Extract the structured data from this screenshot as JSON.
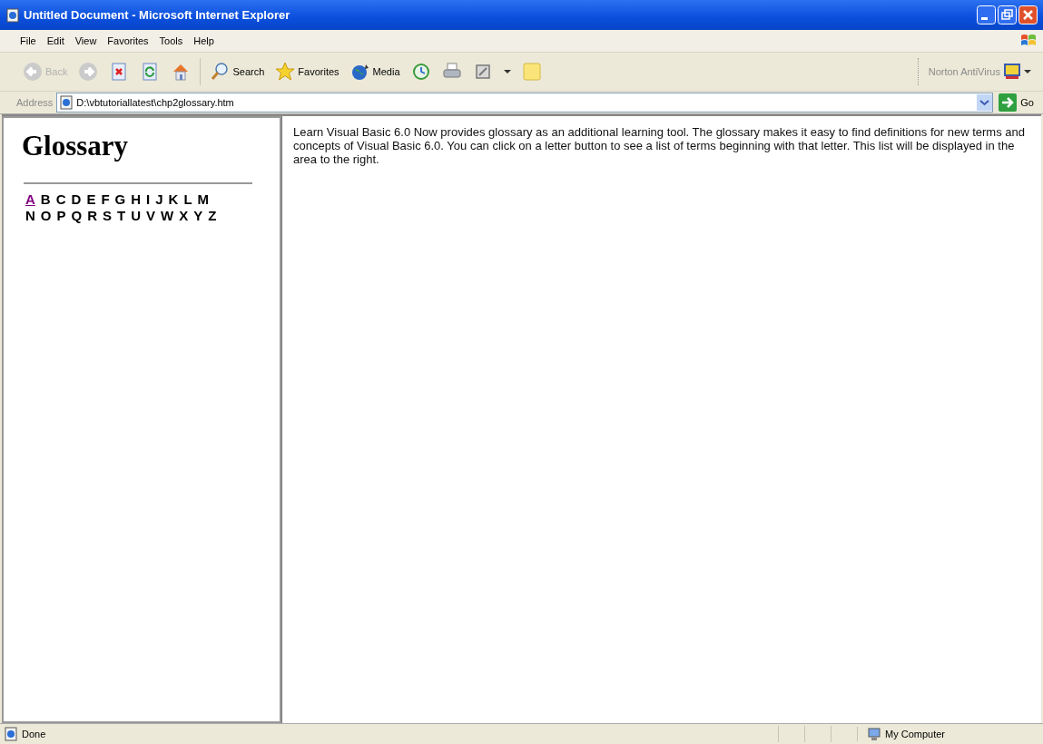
{
  "window": {
    "title": "Untitled Document - Microsoft Internet Explorer"
  },
  "menu": [
    "File",
    "Edit",
    "View",
    "Favorites",
    "Tools",
    "Help"
  ],
  "toolbar": [
    {
      "kind": "back",
      "label": "Back",
      "disabled": true
    },
    {
      "kind": "forward",
      "disabled": true
    },
    {
      "kind": "stop"
    },
    {
      "kind": "refresh"
    },
    {
      "kind": "home"
    },
    {
      "kind": "sep"
    },
    {
      "kind": "search",
      "label": "Search"
    },
    {
      "kind": "favorites",
      "label": "Favorites"
    },
    {
      "kind": "media",
      "label": "Media"
    },
    {
      "kind": "history"
    },
    {
      "kind": "print"
    },
    {
      "kind": "edit"
    },
    {
      "kind": "dropdown"
    },
    {
      "kind": "note"
    }
  ],
  "norton": {
    "label": "Norton AntiVirus"
  },
  "address": {
    "label": "Address",
    "value": "D:\\vbtutoriallatest\\chp2glossary.htm",
    "go": "Go"
  },
  "left_frame": {
    "heading": "Glossary",
    "letter_rows": [
      [
        {
          "letter": "A",
          "visited": true
        },
        {
          "letter": "B",
          "visited": false
        },
        {
          "letter": "C",
          "visited": false
        },
        {
          "letter": "D",
          "visited": false
        },
        {
          "letter": "E",
          "visited": false
        },
        {
          "letter": "F",
          "visited": false
        },
        {
          "letter": "G",
          "visited": false
        },
        {
          "letter": "H",
          "visited": false
        },
        {
          "letter": "I",
          "visited": false
        },
        {
          "letter": "J",
          "visited": false
        },
        {
          "letter": "K",
          "visited": false
        },
        {
          "letter": "L",
          "visited": false
        },
        {
          "letter": "M",
          "visited": false
        }
      ],
      [
        {
          "letter": "N",
          "visited": false
        },
        {
          "letter": "O",
          "visited": false
        },
        {
          "letter": "P",
          "visited": false
        },
        {
          "letter": "Q",
          "visited": false
        },
        {
          "letter": "R",
          "visited": false
        },
        {
          "letter": "S",
          "visited": false
        },
        {
          "letter": "T",
          "visited": false
        },
        {
          "letter": "U",
          "visited": false
        },
        {
          "letter": "V",
          "visited": false
        },
        {
          "letter": "W",
          "visited": false
        },
        {
          "letter": "X",
          "visited": false
        },
        {
          "letter": "Y",
          "visited": false
        },
        {
          "letter": "Z",
          "visited": false
        }
      ]
    ]
  },
  "right_frame": {
    "text": "Learn Visual Basic 6.0 Now provides glossary as an additional learning tool. The glossary makes it easy to find definitions for new terms and concepts of Visual Basic 6.0. You can click on a letter button to see a list of terms beginning with that letter. This list will be displayed in the area to the right."
  },
  "status_bar": {
    "text": "Done",
    "zone": "My Computer"
  }
}
